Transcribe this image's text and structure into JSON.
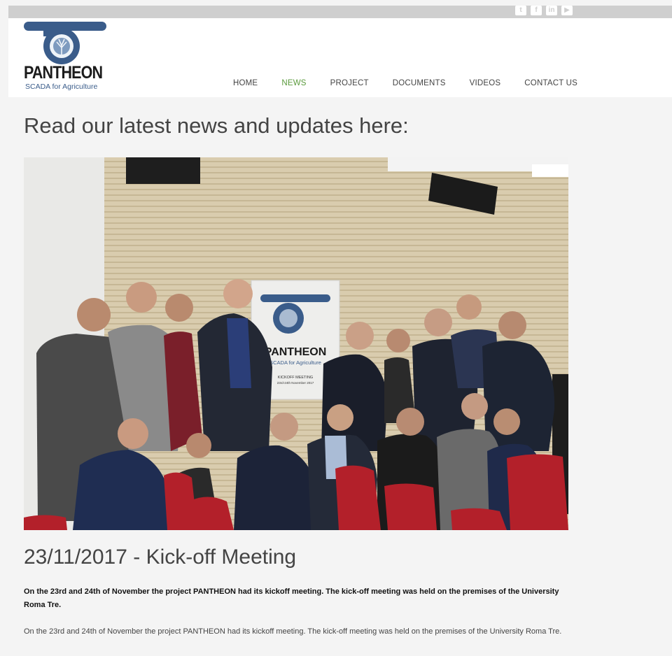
{
  "social": {
    "twitter": {
      "icon": "twitter-icon",
      "glyph": "t"
    },
    "facebook": {
      "icon": "facebook-icon",
      "glyph": "f"
    },
    "linkedin": {
      "icon": "linkedin-icon",
      "glyph": "in"
    },
    "youtube": {
      "icon": "youtube-icon",
      "glyph": "▶"
    }
  },
  "logo": {
    "name": "PANTHEON",
    "tagline": "SCADA for Agriculture"
  },
  "nav": {
    "items": [
      {
        "label": "HOME"
      },
      {
        "label": "NEWS",
        "active": true
      },
      {
        "label": "PROJECT"
      },
      {
        "label": "DOCUMENTS"
      },
      {
        "label": "VIDEOS"
      },
      {
        "label": "CONTACT US"
      }
    ]
  },
  "page": {
    "headline": "Read our latest news and updates here:"
  },
  "photo": {
    "poster_name": "PANTHEON",
    "poster_tagline": "SCADA for Agriculture",
    "poster_event": "KICKOFF MEETING",
    "poster_dates": "23rd-24th November 2017"
  },
  "article": {
    "title": "23/11/2017 - Kick-off Meeting",
    "lead": "On the 23rd and 24th of November the project PANTHEON had its kickoff meeting. The kick-off meeting was held on the premises of the University Roma Tre.",
    "body": "On the 23rd and 24th of November the project PANTHEON had its kickoff meeting. The kick-off meeting was held on the premises of the University Roma Tre."
  },
  "colors": {
    "accent": "#5a9a3c",
    "logo_blue": "#3a5c8a",
    "seat_red": "#b3202a"
  }
}
